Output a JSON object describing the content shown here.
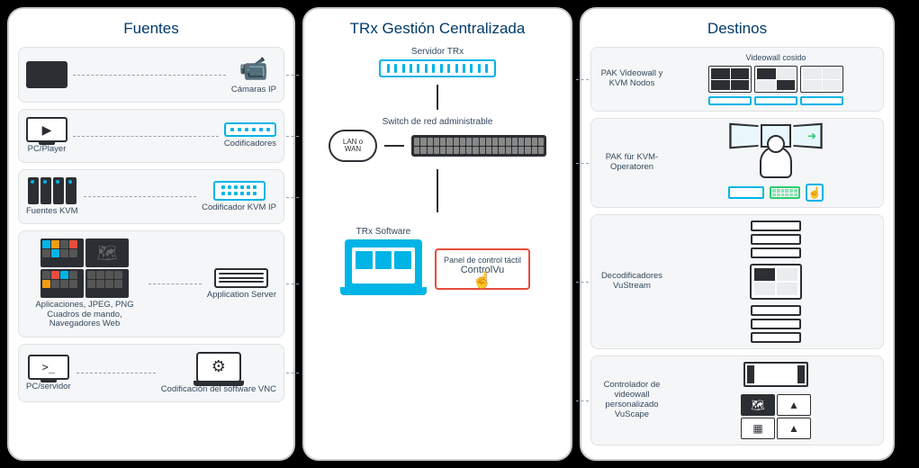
{
  "panels": {
    "sources": {
      "title": "Fuentes"
    },
    "center": {
      "title": "TRx Gestión Centralizada"
    },
    "dest": {
      "title": "Destinos"
    }
  },
  "sources": {
    "row1": {
      "left": "",
      "right": "Cámaras IP"
    },
    "row2": {
      "left": "PC/Player",
      "right": "Codificadores"
    },
    "row3": {
      "left": "Fuentes KVM",
      "right": "Codificador KVM IP"
    },
    "row4": {
      "left": "Aplicaciones, JPEG, PNG Cuadros de mando, Navegadores Web",
      "right": "Application Server"
    },
    "row5": {
      "left": "PC/servidor",
      "right": "Codificación del software VNC"
    }
  },
  "center": {
    "server_label": "Servidor TRx",
    "switch_label": "Switch de red administrable",
    "cloud_line1": "LAN o",
    "cloud_line2": "WAN",
    "software_label": "TRx Software",
    "touch_line1": "Panel de control táctil",
    "touch_line2": "ControlVu"
  },
  "dest": {
    "row1": {
      "label": "PAK Videowall y KVM Nodos",
      "sub": "Videowall cosido"
    },
    "row2": {
      "label": "PAK für KVM-Operatoren"
    },
    "row3": {
      "label": "Decodificadores VuStream"
    },
    "row4": {
      "label": "Controlador de videowall personalizado VuScape"
    }
  }
}
